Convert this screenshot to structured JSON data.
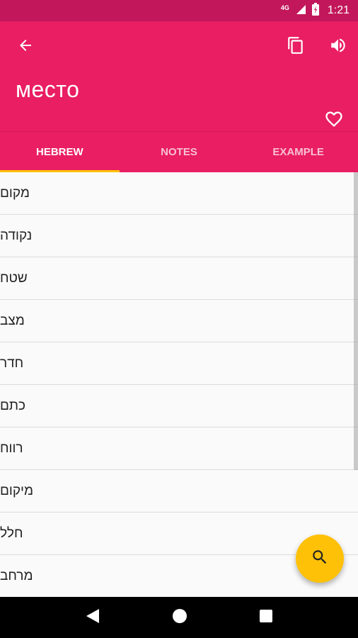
{
  "status_bar": {
    "network": "4G",
    "time": "1:21"
  },
  "toolbar": {
    "back_icon": "arrow-left-icon",
    "copy_icon": "copy-icon",
    "speaker_icon": "volume-up-icon",
    "favorite_icon": "heart-outline-icon"
  },
  "word": {
    "title": "место"
  },
  "tabs": [
    {
      "label": "HEBREW",
      "active": true
    },
    {
      "label": "NOTES",
      "active": false
    },
    {
      "label": "EXAMPLE",
      "active": false
    }
  ],
  "translations": [
    "מקום",
    "נקודה",
    "שטח",
    "מצב",
    "חדר",
    "כתם",
    "רווח",
    "מיקום",
    "חלל",
    "מרחב"
  ],
  "fab": {
    "icon": "search-icon"
  },
  "nav_bar": {
    "back_icon": "nav-back-icon",
    "home_icon": "nav-home-icon",
    "recents_icon": "nav-recents-icon"
  },
  "colors": {
    "primary": "#e91e63",
    "primary_dark": "#c2185b",
    "accent": "#ffc107"
  }
}
